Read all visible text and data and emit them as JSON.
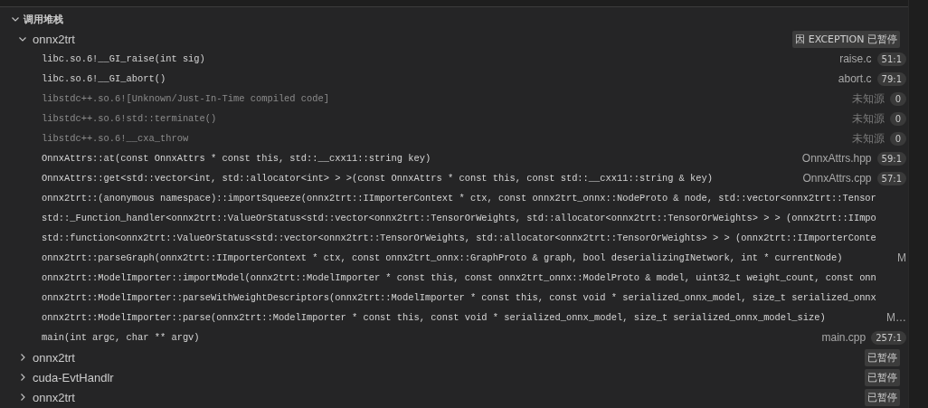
{
  "panel": {
    "title": "调用堆栈",
    "expanded": true
  },
  "threads": [
    {
      "name": "onnx2trt",
      "expanded": true,
      "badge": "因 EXCEPTION 已暂停",
      "frames": [
        {
          "label": "libc.so.6!__GI_raise(int sig)",
          "source": "raise.c",
          "line": "51:1",
          "dim": false
        },
        {
          "label": "libc.so.6!__GI_abort()",
          "source": "abort.c",
          "line": "79:1",
          "dim": false
        },
        {
          "label": "libstdc++.so.6![Unknown/Just-In-Time compiled code]",
          "source": "未知源",
          "line": "0",
          "dim": true
        },
        {
          "label": "libstdc++.so.6!std::terminate()",
          "source": "未知源",
          "line": "0",
          "dim": true
        },
        {
          "label": "libstdc++.so.6!__cxa_throw",
          "source": "未知源",
          "line": "0",
          "dim": true
        },
        {
          "label": "OnnxAttrs::at(const OnnxAttrs * const this, std::__cxx11::string key)",
          "source": "OnnxAttrs.hpp",
          "line": "59:1",
          "dim": false
        },
        {
          "label": "OnnxAttrs::get<std::vector<int, std::allocator<int> > >(const OnnxAttrs * const this, const std::__cxx11::string & key)",
          "source": "OnnxAttrs.cpp",
          "line": "57:1",
          "dim": false
        },
        {
          "label": "onnx2trt::(anonymous namespace)::importSqueeze(onnx2trt::IImporterContext * ctx, const onnx2trt_onnx::NodeProto & node, std::vector<onnx2trt::Tensor",
          "dim": false
        },
        {
          "label": "std::_Function_handler<onnx2trt::ValueOrStatus<std::vector<onnx2trt::TensorOrWeights, std::allocator<onnx2trt::TensorOrWeights> > > (onnx2trt::IImpo",
          "dim": false
        },
        {
          "label": "std::function<onnx2trt::ValueOrStatus<std::vector<onnx2trt::TensorOrWeights, std::allocator<onnx2trt::TensorOrWeights> > > (onnx2trt::IImporterConte",
          "dim": false
        },
        {
          "label": "onnx2trt::parseGraph(onnx2trt::IImporterContext * ctx, const onnx2trt_onnx::GraphProto & graph, bool deserializingINetwork, int * currentNode)",
          "source": "M",
          "dim": false
        },
        {
          "label": "onnx2trt::ModelImporter::importModel(onnx2trt::ModelImporter * const this, const onnx2trt_onnx::ModelProto & model, uint32_t weight_count, const onn",
          "dim": false
        },
        {
          "label": "onnx2trt::ModelImporter::parseWithWeightDescriptors(onnx2trt::ModelImporter * const this, const void * serialized_onnx_model, size_t serialized_onnx",
          "dim": false
        },
        {
          "label": "onnx2trt::ModelImporter::parse(onnx2trt::ModelImporter * const this, const void * serialized_onnx_model, size_t serialized_onnx_model_size)",
          "source": "M…",
          "dim": false
        },
        {
          "label": "main(int argc, char ** argv)",
          "source": "main.cpp",
          "line": "257:1",
          "dim": false
        }
      ]
    },
    {
      "name": "onnx2trt",
      "expanded": false,
      "badge": "已暂停"
    },
    {
      "name": "cuda-EvtHandlr",
      "expanded": false,
      "badge": "已暂停"
    },
    {
      "name": "onnx2trt",
      "expanded": false,
      "badge": "已暂停"
    }
  ]
}
